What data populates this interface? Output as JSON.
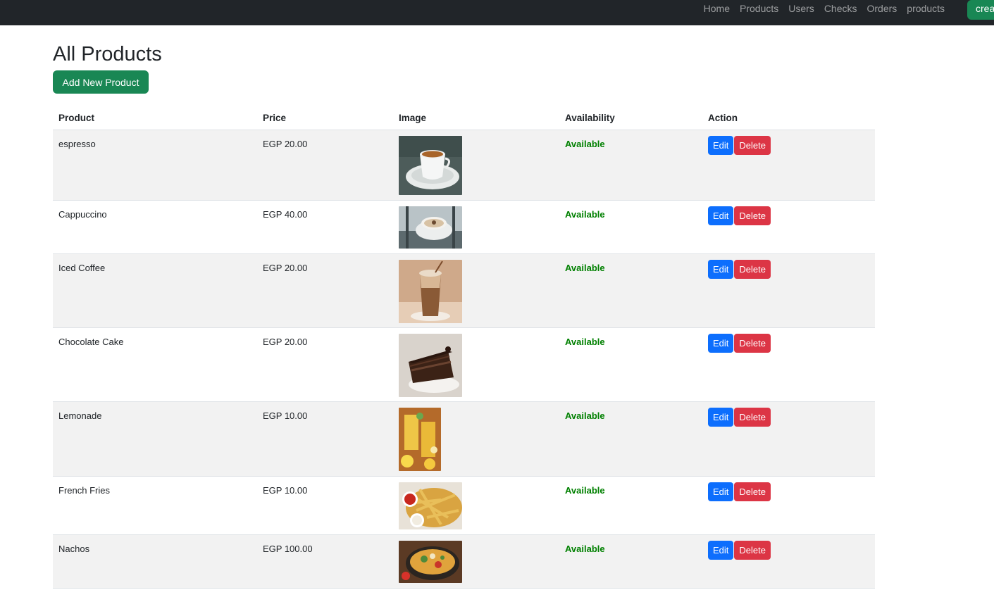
{
  "nav": {
    "links": [
      "Home",
      "Products",
      "Users",
      "Checks",
      "Orders",
      "products"
    ],
    "create_label": "crea"
  },
  "page": {
    "title": "All Products",
    "add_button": "Add New Product"
  },
  "table": {
    "headers": [
      "Product",
      "Price",
      "Image",
      "Availability",
      "Action"
    ],
    "edit_label": "Edit",
    "delete_label": "Delete",
    "rows": [
      {
        "product": "espresso",
        "price": "EGP 20.00",
        "availability": "Available",
        "image": "espresso-photo"
      },
      {
        "product": "Cappuccino",
        "price": "EGP 40.00",
        "availability": "Available",
        "image": "cappuccino-photo"
      },
      {
        "product": "Iced Coffee",
        "price": "EGP 20.00",
        "availability": "Available",
        "image": "iced-coffee-photo"
      },
      {
        "product": "Chocolate Cake",
        "price": "EGP 20.00",
        "availability": "Available",
        "image": "chocolate-cake-photo"
      },
      {
        "product": "Lemonade",
        "price": "EGP 10.00",
        "availability": "Available",
        "image": "lemonade-photo"
      },
      {
        "product": "French Fries",
        "price": "EGP 10.00",
        "availability": "Available",
        "image": "french-fries-photo"
      },
      {
        "product": "Nachos",
        "price": "EGP 100.00",
        "availability": "Available",
        "image": "nachos-photo"
      }
    ]
  },
  "colors": {
    "navbar": "#212529",
    "success": "#198754",
    "primary": "#0d6efd",
    "danger": "#dc3545",
    "available": "#008000",
    "stripe": "#f2f2f2"
  }
}
